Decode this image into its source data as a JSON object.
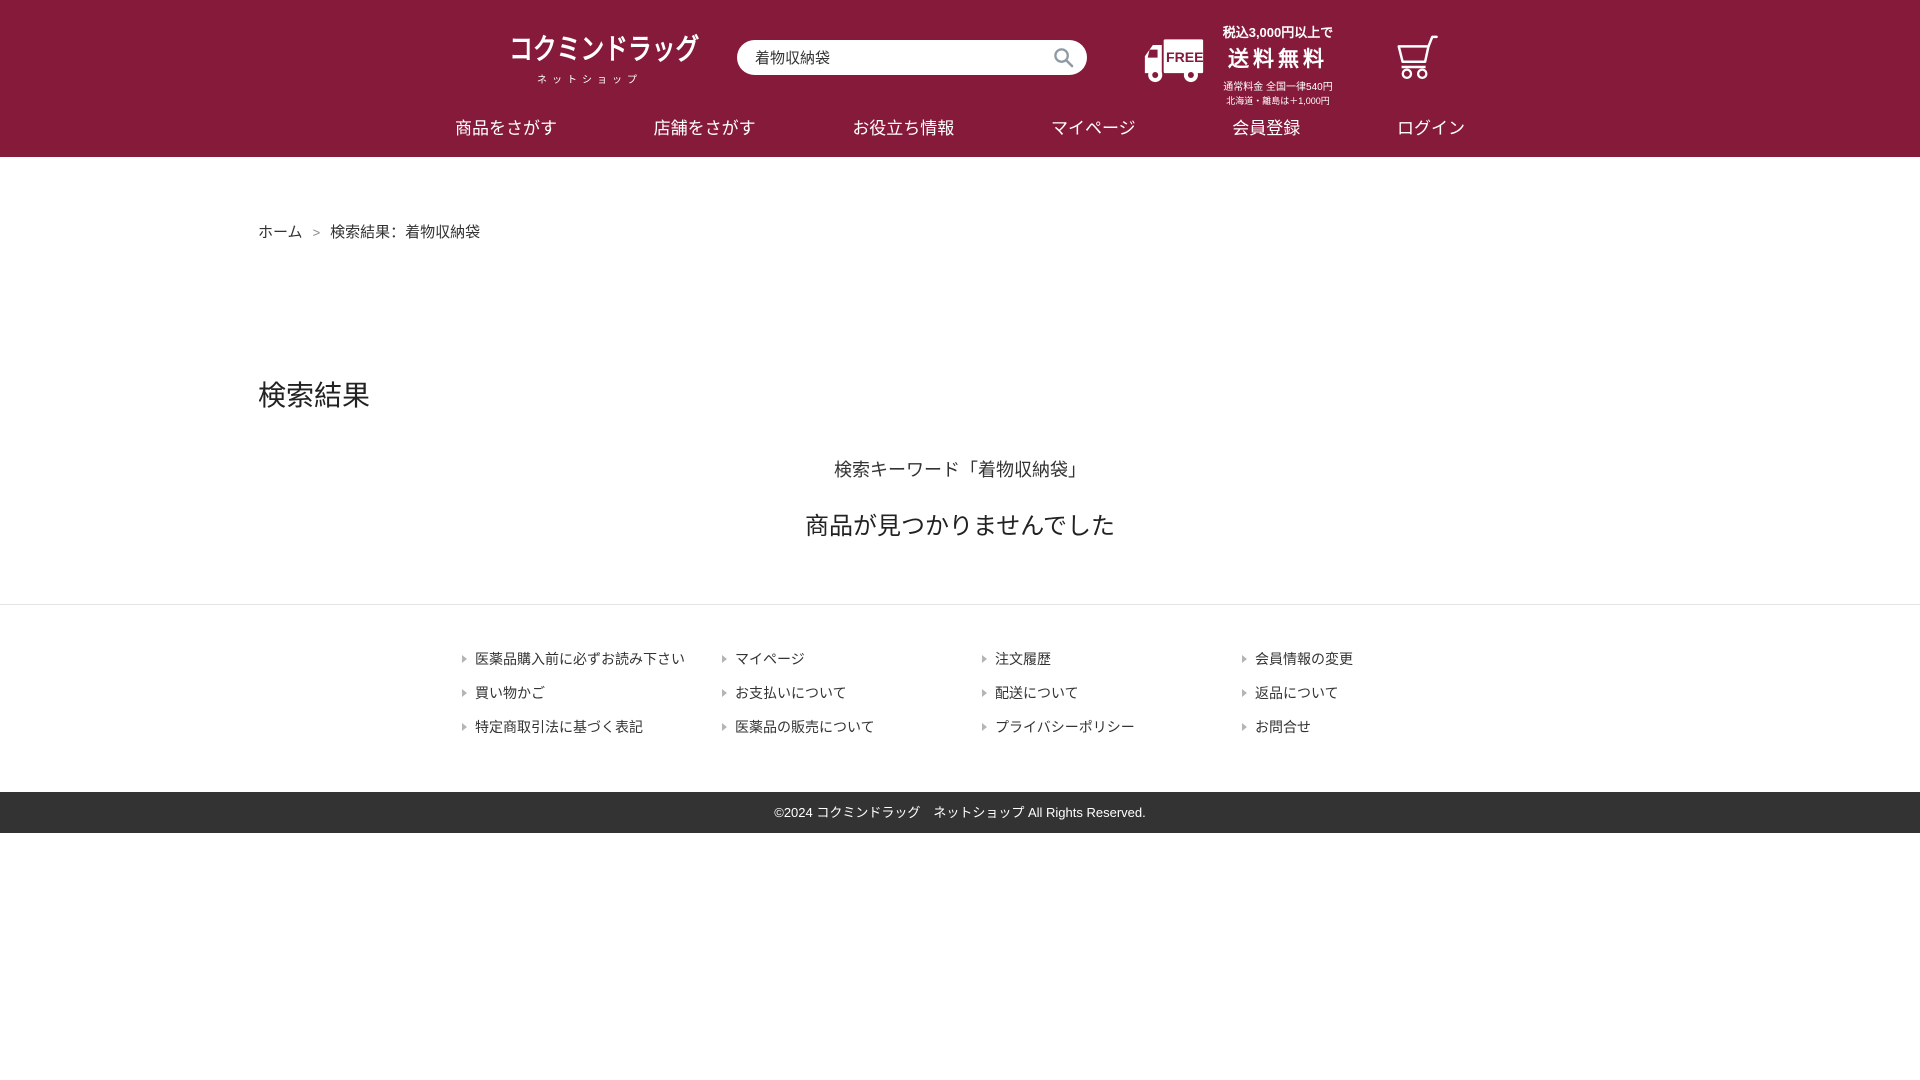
{
  "colors": {
    "brand": "#861a3b",
    "copyright_bar": "#333333"
  },
  "header": {
    "logo": {
      "title": "コクミンドラッグ",
      "subtitle": "ネットショップ"
    },
    "search": {
      "value": "着物収納袋"
    },
    "shipping": {
      "free_badge": "FREE",
      "line1": "税込3,000円以上で",
      "line2": "送料無料",
      "line3": "通常料金 全国一律540円",
      "line4": "北海道・離島は＋1,000円"
    },
    "nav": [
      {
        "label": "商品をさがす"
      },
      {
        "label": "店舗をさがす"
      },
      {
        "label": "お役立ち情報"
      },
      {
        "label": "マイページ"
      },
      {
        "label": "会員登録"
      },
      {
        "label": "ログイン"
      }
    ]
  },
  "breadcrumb": {
    "home": "ホーム",
    "separator": ">",
    "current": "検索結果：着物収納袋"
  },
  "main": {
    "title": "検索結果",
    "keyword_line": "検索キーワード「着物収納袋」",
    "no_results": "商品が見つかりませんでした"
  },
  "footer": {
    "columns": [
      {
        "links": [
          "医薬品購入前に必ずお読み下さい",
          "買い物かご",
          "特定商取引法に基づく表記"
        ]
      },
      {
        "links": [
          "マイページ",
          "お支払いについて",
          "医薬品の販売について"
        ]
      },
      {
        "links": [
          "注文履歴",
          "配送について",
          "プライバシーポリシー"
        ]
      },
      {
        "links": [
          "会員情報の変更",
          "返品について",
          "お問合せ"
        ]
      }
    ],
    "copyright": "©2024 コクミンドラッグ　ネットショップ All Rights Reserved."
  }
}
